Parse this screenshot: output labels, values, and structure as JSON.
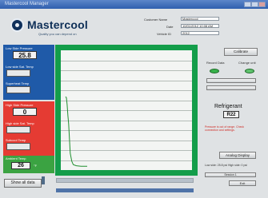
{
  "window": {
    "title": "Mastercool Manager"
  },
  "brand": {
    "name": "Mastercool",
    "tagline": "Quality you can depend on"
  },
  "customer": {
    "name_label": "Customer Name",
    "name_value": "Mastercool",
    "date_label": "Date",
    "date_value": "10/01/2012  10:08 AM",
    "vehicle_label": "Vehicle ID",
    "vehicle_value": "2012"
  },
  "blue_panel": {
    "title": "Low Side Pressure",
    "value": "25.8",
    "label2": "Low side Sat. Temp",
    "label3": "Superheat Temp"
  },
  "red_panel": {
    "title": "High Side Pressure",
    "value": "0",
    "label2": "High side Sat. Temp",
    "label3": "Subcool Temp"
  },
  "green_panel": {
    "title": "Ambient Temp",
    "value": "26",
    "unit": "°F"
  },
  "buttons": {
    "show_all_data": "Show all data",
    "calibrate": "Calibrate",
    "analog_display": "Analog Display"
  },
  "right": {
    "label_left": "Record Data",
    "label_right": "Change unit",
    "refrigerant_label": "Refrigerant",
    "refrigerant_value": "R22",
    "warning": "Pressure is out of range. Check connection and settings.",
    "foot1": "Low side: 25.8 psi  High side: 0 psi",
    "foot2": "Session 1",
    "foot3": "Exit"
  },
  "chart_data": {
    "type": "line",
    "title": "",
    "xlabel": "",
    "ylabel": "",
    "series": [
      {
        "name": "",
        "x": [
          0,
          1,
          2,
          3,
          4,
          5,
          6,
          8,
          10,
          14,
          20,
          28
        ],
        "y": [
          62,
          61,
          55,
          45,
          38,
          25,
          12,
          5,
          2,
          1,
          0.5,
          0.5
        ]
      }
    ],
    "xlim": [
      0,
      160
    ],
    "ylim": [
      0,
      100
    ],
    "grid": true,
    "line_color": "#1f8f2f",
    "colors": {
      "frame": "#139d4a",
      "background": "#f3f5f3",
      "grid": "#b5bdb8"
    }
  }
}
